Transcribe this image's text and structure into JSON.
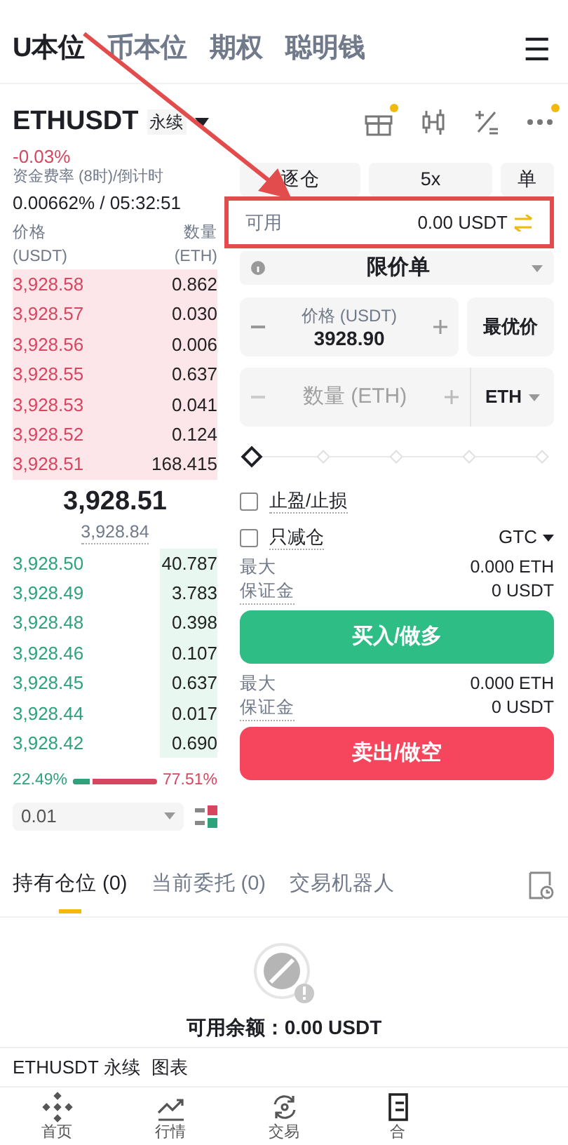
{
  "top_tabs": [
    {
      "label": "U本位",
      "selected": true
    },
    {
      "label": "币本位",
      "selected": false
    },
    {
      "label": "期权",
      "selected": false
    },
    {
      "label": "聪明钱",
      "selected": false
    }
  ],
  "menu_icon": "☰",
  "symbol": {
    "name": "ETHUSDT",
    "type": "永续",
    "change": "-0.03%"
  },
  "funding": {
    "label": "资金费率 (8时)/倒计时",
    "value": "0.00662% / 05:32:51"
  },
  "orderbook": {
    "price_header": "价格",
    "price_unit": "(USDT)",
    "qty_header": "数量",
    "qty_unit": "(ETH)",
    "asks": [
      {
        "price": "3,928.58",
        "qty": "0.862"
      },
      {
        "price": "3,928.57",
        "qty": "0.030"
      },
      {
        "price": "3,928.56",
        "qty": "0.006"
      },
      {
        "price": "3,928.55",
        "qty": "0.637"
      },
      {
        "price": "3,928.53",
        "qty": "0.041"
      },
      {
        "price": "3,928.52",
        "qty": "0.124"
      },
      {
        "price": "3,928.51",
        "qty": "168.415"
      }
    ],
    "last_price": "3,928.51",
    "mark_price": "3,928.84",
    "bids": [
      {
        "price": "3,928.50",
        "qty": "40.787"
      },
      {
        "price": "3,928.49",
        "qty": "3.783"
      },
      {
        "price": "3,928.48",
        "qty": "0.398"
      },
      {
        "price": "3,928.46",
        "qty": "0.107"
      },
      {
        "price": "3,928.45",
        "qty": "0.637"
      },
      {
        "price": "3,928.44",
        "qty": "0.017"
      },
      {
        "price": "3,928.42",
        "qty": "0.690"
      }
    ],
    "buy_ratio": "22.49%",
    "sell_ratio": "77.51%",
    "ratio_bar": {
      "level": 0.2249
    },
    "precision": "0.01"
  },
  "order_form": {
    "margin_mode": "逐仓",
    "leverage": "5x",
    "position_mode": "单",
    "available": {
      "label": "可用",
      "value": "0.00 USDT",
      "highlighted": true
    },
    "order_type": "限价单",
    "price": {
      "label": "价格 (USDT)",
      "value": "3928.90"
    },
    "best_price": "最优价",
    "quantity": {
      "placeholder": "数量 (ETH)",
      "unit": "ETH"
    },
    "slider": {
      "level": 0
    },
    "options": [
      {
        "label": "止盈/止损",
        "checked": false
      },
      {
        "label": "只减仓",
        "checked": false
      }
    ],
    "time_in_force": "GTC",
    "buy": {
      "max_label": "最大",
      "max_value": "0.000 ETH",
      "margin_label": "保证金",
      "margin_value": "0 USDT",
      "button": "买入/做多"
    },
    "sell": {
      "max_label": "最大",
      "max_value": "0.000 ETH",
      "margin_label": "保证金",
      "margin_value": "0 USDT",
      "button": "卖出/做空"
    }
  },
  "bottom_tabs": [
    {
      "label": "持有仓位 (0)",
      "selected": true
    },
    {
      "label": "当前委托 (0)",
      "selected": false
    },
    {
      "label": "交易机器人",
      "selected": false
    }
  ],
  "empty_state": {
    "text": "可用余额：0.00 USDT"
  },
  "chart_bar": {
    "symbol": "ETHUSDT 永续",
    "link": "图表"
  },
  "nav": [
    {
      "label": "首页",
      "kind": "home"
    },
    {
      "label": "行情",
      "kind": "markets"
    },
    {
      "label": "交易",
      "kind": "trade"
    },
    {
      "label": "合",
      "kind": "futures"
    }
  ]
}
